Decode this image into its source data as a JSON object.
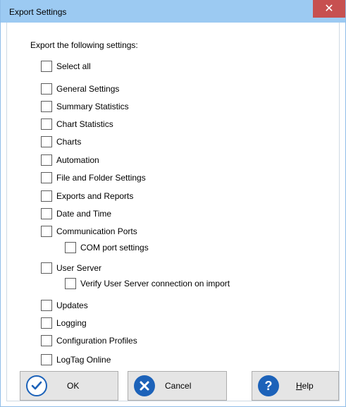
{
  "dialog": {
    "title": "Export Settings",
    "close_label": "✕",
    "heading": "Export the following settings:"
  },
  "options": {
    "select_all": "Select all",
    "general_settings": "General Settings",
    "summary_statistics": "Summary Statistics",
    "chart_statistics": "Chart Statistics",
    "charts": "Charts",
    "automation": "Automation",
    "file_folder_settings": "File and Folder Settings",
    "exports_reports": "Exports and Reports",
    "date_time": "Date and Time",
    "communication_ports": "Communication Ports",
    "com_port_settings": "COM port settings",
    "user_server": "User Server",
    "verify_user_server": "Verify User Server connection on import",
    "updates": "Updates",
    "logging": "Logging",
    "configuration_profiles": "Configuration Profiles",
    "logtag_online": "LogTag Online"
  },
  "buttons": {
    "ok": "OK",
    "cancel": "Cancel",
    "help_first": "H",
    "help_rest": "elp"
  },
  "colors": {
    "titlebar": "#9ccaf2",
    "close": "#c75050",
    "icon_blue": "#1c62b9"
  }
}
